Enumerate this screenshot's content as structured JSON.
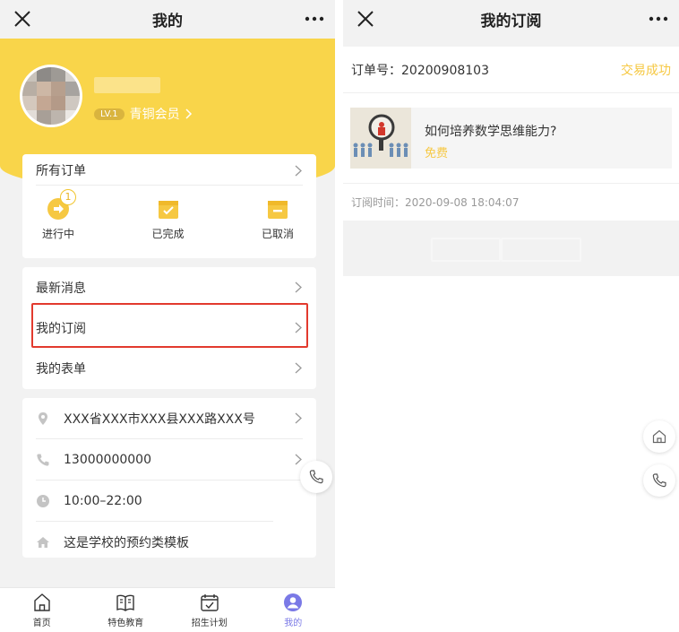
{
  "left": {
    "title": "我的",
    "user": {
      "level_badge": "LV.1",
      "member_label": "青铜会员"
    },
    "orders": {
      "label": "所有订单",
      "statuses": [
        {
          "label": "进行中",
          "count": "1",
          "icon": "in-progress-icon"
        },
        {
          "label": "已完成",
          "icon": "completed-icon"
        },
        {
          "label": "已取消",
          "icon": "cancelled-icon"
        }
      ]
    },
    "menu": [
      {
        "label": "最新消息"
      },
      {
        "label": "我的订阅"
      },
      {
        "label": "我的表单"
      }
    ],
    "info": [
      {
        "label": "XXX省XXX市XXX县XXX路XXX号",
        "icon": "location-icon"
      },
      {
        "label": "13000000000",
        "icon": "phone-icon"
      },
      {
        "label": "10:00–22:00",
        "icon": "clock-icon"
      },
      {
        "label": "这是学校的预约类模板",
        "icon": "home-icon"
      }
    ],
    "tabs": [
      {
        "label": "首页",
        "icon": "home-tab-icon"
      },
      {
        "label": "特色教育",
        "icon": "book-tab-icon"
      },
      {
        "label": "招生计划",
        "icon": "calendar-tab-icon"
      },
      {
        "label": "我的",
        "icon": "profile-tab-icon"
      }
    ],
    "colors": {
      "brand_yellow": "#f9d54a",
      "active_tab": "#7a79e6",
      "highlight_red": "#e23a2e"
    }
  },
  "right": {
    "title": "我的订阅",
    "order_no": "订单号：20200908103",
    "status": "交易成功",
    "product_title": "如何培养数学思维能力?",
    "product_price": "免费",
    "subscribe_time": "订阅时间：2020-09-08 18:04:07"
  }
}
